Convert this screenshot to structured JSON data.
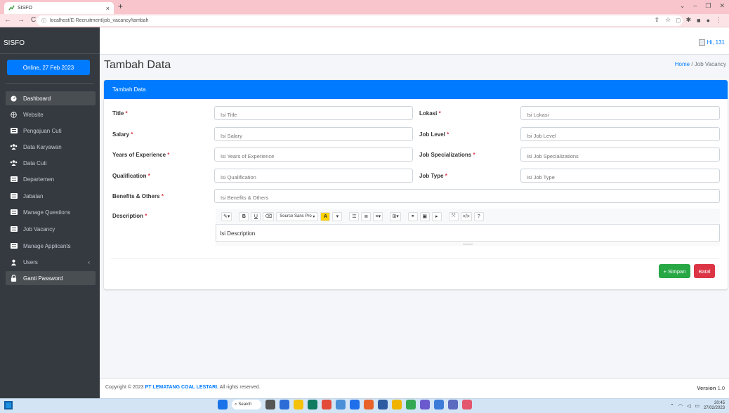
{
  "browser": {
    "tab_title": "SISFO",
    "tab_close": "×",
    "new_tab": "+",
    "url": "localhost/E-Recruitment/job_vacancy/tambah",
    "window_controls": [
      "⌄",
      "–",
      "❐",
      "✕"
    ]
  },
  "app": {
    "brand": "SISFO",
    "online_label": "Online, 27 Feb 2023",
    "user_greeting": "Hi, 131"
  },
  "sidebar": {
    "items": [
      {
        "label": "Dashboard",
        "icon": "dashboard-icon"
      },
      {
        "label": "Website",
        "icon": "globe-icon"
      },
      {
        "label": "Pengajuan Cuti",
        "icon": "list-icon"
      },
      {
        "label": "Data Karyawan",
        "icon": "users-icon"
      },
      {
        "label": "Data Cuti",
        "icon": "users-icon"
      },
      {
        "label": "Departemen",
        "icon": "list-icon"
      },
      {
        "label": "Jabatan",
        "icon": "list-icon"
      },
      {
        "label": "Manage Questions",
        "icon": "list-icon"
      },
      {
        "label": "Job Vacancy",
        "icon": "list-icon"
      },
      {
        "label": "Manage Applicants",
        "icon": "list-icon"
      },
      {
        "label": "Users",
        "icon": "user-icon"
      },
      {
        "label": "Ganti Password",
        "icon": "lock-icon"
      }
    ],
    "users_arrow": "‹"
  },
  "page": {
    "title": "Tambah Data",
    "breadcrumb_home": "Home",
    "breadcrumb_sep": "/",
    "breadcrumb_current": "Job Vacancy"
  },
  "form": {
    "card_title": "Tambah Data",
    "required_mark": "*",
    "fields": {
      "title": {
        "label": "Title",
        "placeholder": "Isi Title"
      },
      "lokasi": {
        "label": "Lokasi",
        "placeholder": "Isi Lokasi"
      },
      "salary": {
        "label": "Salary",
        "placeholder": "Isi Salary"
      },
      "job_level": {
        "label": "Job Level",
        "placeholder": "Isi Job Level"
      },
      "years": {
        "label": "Years of Experience",
        "placeholder": "Isi Years of Experience"
      },
      "specializations": {
        "label": "Job Specializations",
        "placeholder": "Isi Job Specializations"
      },
      "qualification": {
        "label": "Qualification",
        "placeholder": "Isi Qualification"
      },
      "job_type": {
        "label": "Job Type",
        "placeholder": "Isi Job Type"
      },
      "benefits": {
        "label": "Benefits & Others",
        "placeholder": "Isi Benefits & Others"
      },
      "description": {
        "label": "Description",
        "placeholder": "Isi Description"
      }
    },
    "editor_font": "Source Sans Pro",
    "save_label": "Simpan",
    "cancel_label": "Batal"
  },
  "footer": {
    "copyright_prefix": "Copyright © 2023",
    "company": "PT LEMATANG COAL LESTARI.",
    "rights": "All rights reserved.",
    "version_label": "Version",
    "version_number": "1.0"
  },
  "taskbar": {
    "search_label": "Search",
    "time": "20:45",
    "date": "27/02/2023"
  },
  "colors": {
    "primary": "#007bff",
    "success": "#28a745",
    "danger": "#dc3545",
    "sidebar": "#343a40"
  }
}
